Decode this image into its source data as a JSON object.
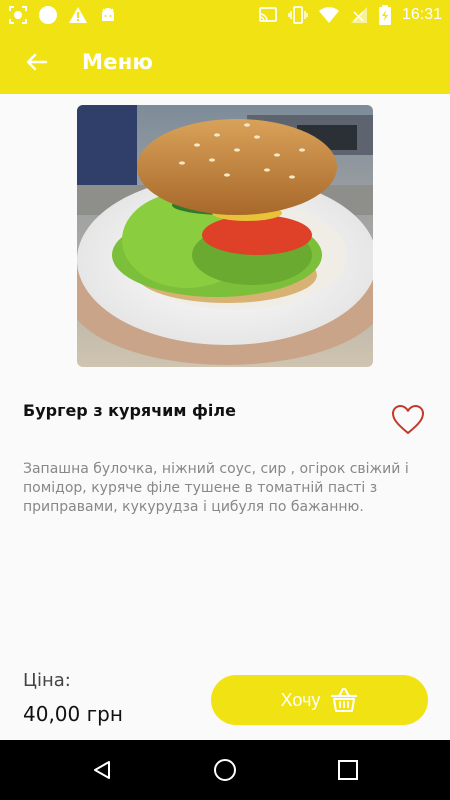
{
  "status_bar": {
    "time": "16:31",
    "background": "#f1e313"
  },
  "app_bar": {
    "title": "Меню",
    "back_icon": "arrow-left-icon"
  },
  "dish": {
    "image": "burger-photo",
    "title": "Бургер з курячим філе",
    "favorite_icon": "heart-outline-icon",
    "description": "Запашна булочка, ніжний соус, сир , огірок свіжий і помідор, куряче філе тушене в томатній пасті з приправами, кукурудза і цибуля по бажанню."
  },
  "footer": {
    "price_label": "Ціна:",
    "price_value": "40,00 грн",
    "want_button": "Хочу",
    "want_icon": "basket-icon"
  },
  "nav_bar": {
    "back_icon": "nav-back-icon",
    "home_icon": "nav-home-icon",
    "recents_icon": "nav-recents-icon"
  },
  "colors": {
    "accent": "#f1e313",
    "heart": "#c0392b",
    "text_secondary": "#888888"
  }
}
